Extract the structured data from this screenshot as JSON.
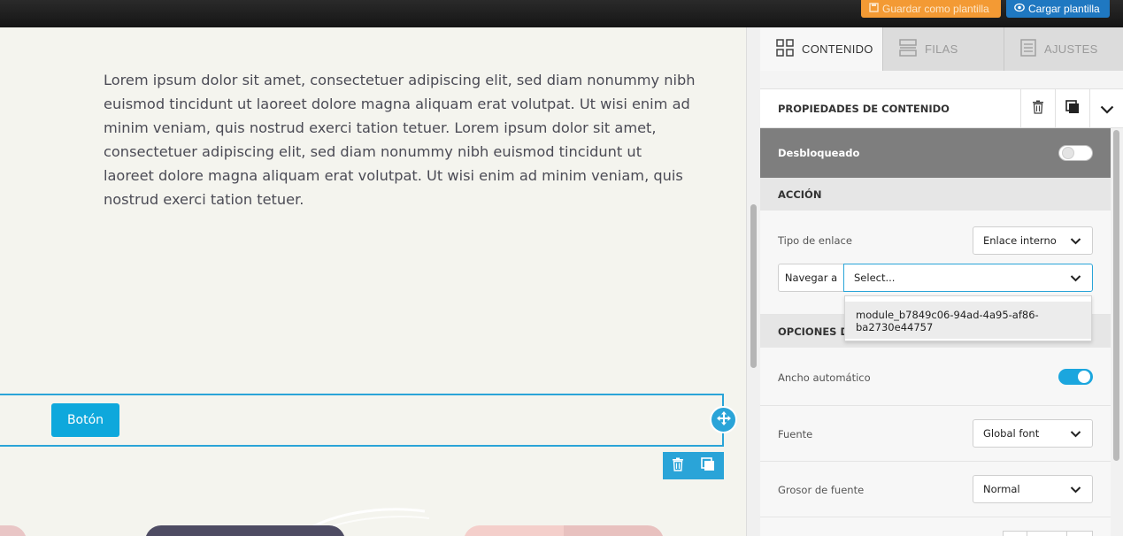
{
  "topbar": {
    "save_template_label": "Guardar como plantilla",
    "load_template_label": "Cargar plantilla"
  },
  "canvas": {
    "lorem_text": "Lorem ipsum dolor sit amet, consectetuer adipiscing elit, sed diam nonummy nibh euismod tincidunt ut laoreet dolore magna aliquam erat volutpat. Ut wisi enim ad minim veniam, quis nostrud exerci tation tetuer. Lorem ipsum dolor sit amet, consectetuer adipiscing elit, sed diam nonummy nibh euismod tincidunt ut laoreet dolore magna aliquam erat volutpat. Ut wisi enim ad minim veniam, quis nostrud exerci tation tetuer.",
    "button_label": "Botón"
  },
  "panel": {
    "tabs": [
      {
        "label": "CONTENIDO",
        "icon": "grid-icon",
        "active": true
      },
      {
        "label": "FILAS",
        "icon": "rows-icon",
        "active": false
      },
      {
        "label": "AJUSTES",
        "icon": "settings-doc-icon",
        "active": false
      }
    ],
    "section_title": "PROPIEDADES DE CONTENIDO",
    "unlocked_label": "Desbloqueado",
    "unlocked_on": false,
    "action_group": "ACCIÓN",
    "link_type_label": "Tipo de enlace",
    "link_type_value": "Enlace interno",
    "navigate_label": "Navegar a",
    "navigate_placeholder": "Select...",
    "dropdown_option": "module_b7849c06-94ad-4a95-af86-ba2730e44757",
    "options_group": "OPCIONES DE",
    "auto_width_label": "Ancho automático",
    "auto_width_on": true,
    "font_label": "Fuente",
    "font_value": "Global font",
    "font_weight_label": "Grosor de fuente",
    "font_weight_value": "Normal"
  },
  "colors": {
    "accent": "#2aa4d8",
    "save_button": "#f39a34",
    "load_button": "#1f78c1",
    "button_blue": "#0ea8dc"
  }
}
